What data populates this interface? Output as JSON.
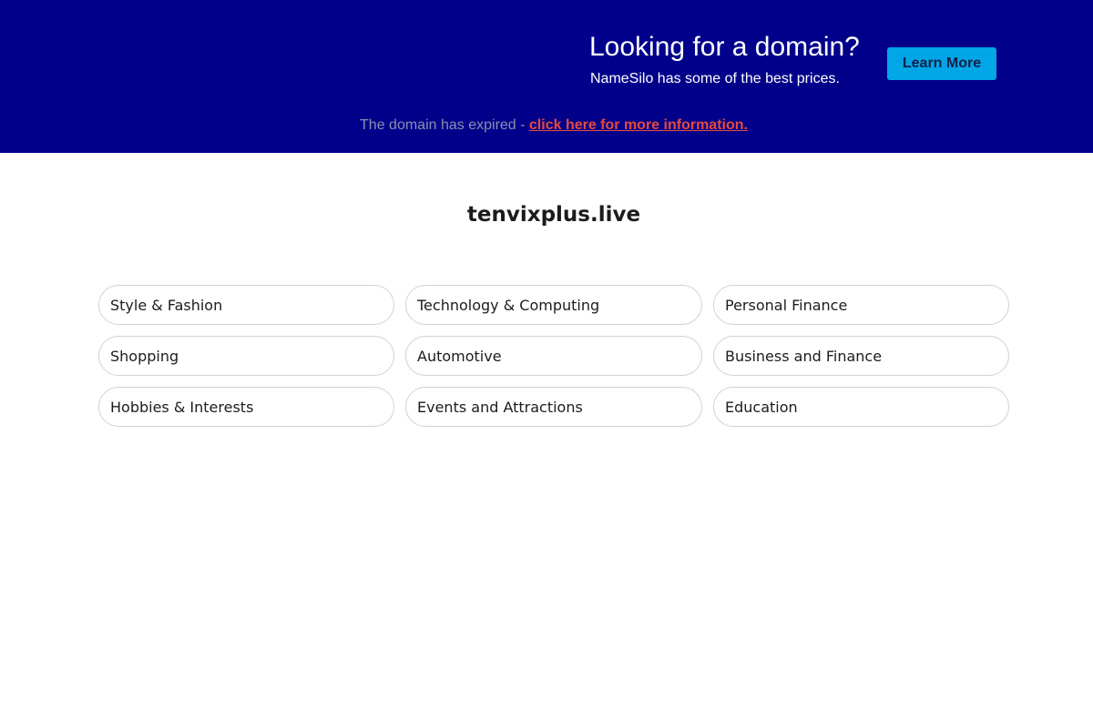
{
  "banner": {
    "headline": "Looking for a domain?",
    "subtext": "NameSilo has some of the best prices.",
    "button_label": "Learn More",
    "background_color": "#00008b",
    "button_color": "#00a6e6"
  },
  "notice": {
    "text": "The domain has expired - ",
    "link_text": "click here for more information.",
    "link_color": "#e84a3c"
  },
  "domain": {
    "name": "tenvixplus.live"
  },
  "categories": [
    {
      "label": "Style & Fashion"
    },
    {
      "label": "Technology & Computing"
    },
    {
      "label": "Personal Finance"
    },
    {
      "label": "Shopping"
    },
    {
      "label": "Automotive"
    },
    {
      "label": "Business and Finance"
    },
    {
      "label": "Hobbies & Interests"
    },
    {
      "label": "Events and Attractions"
    },
    {
      "label": "Education"
    }
  ]
}
